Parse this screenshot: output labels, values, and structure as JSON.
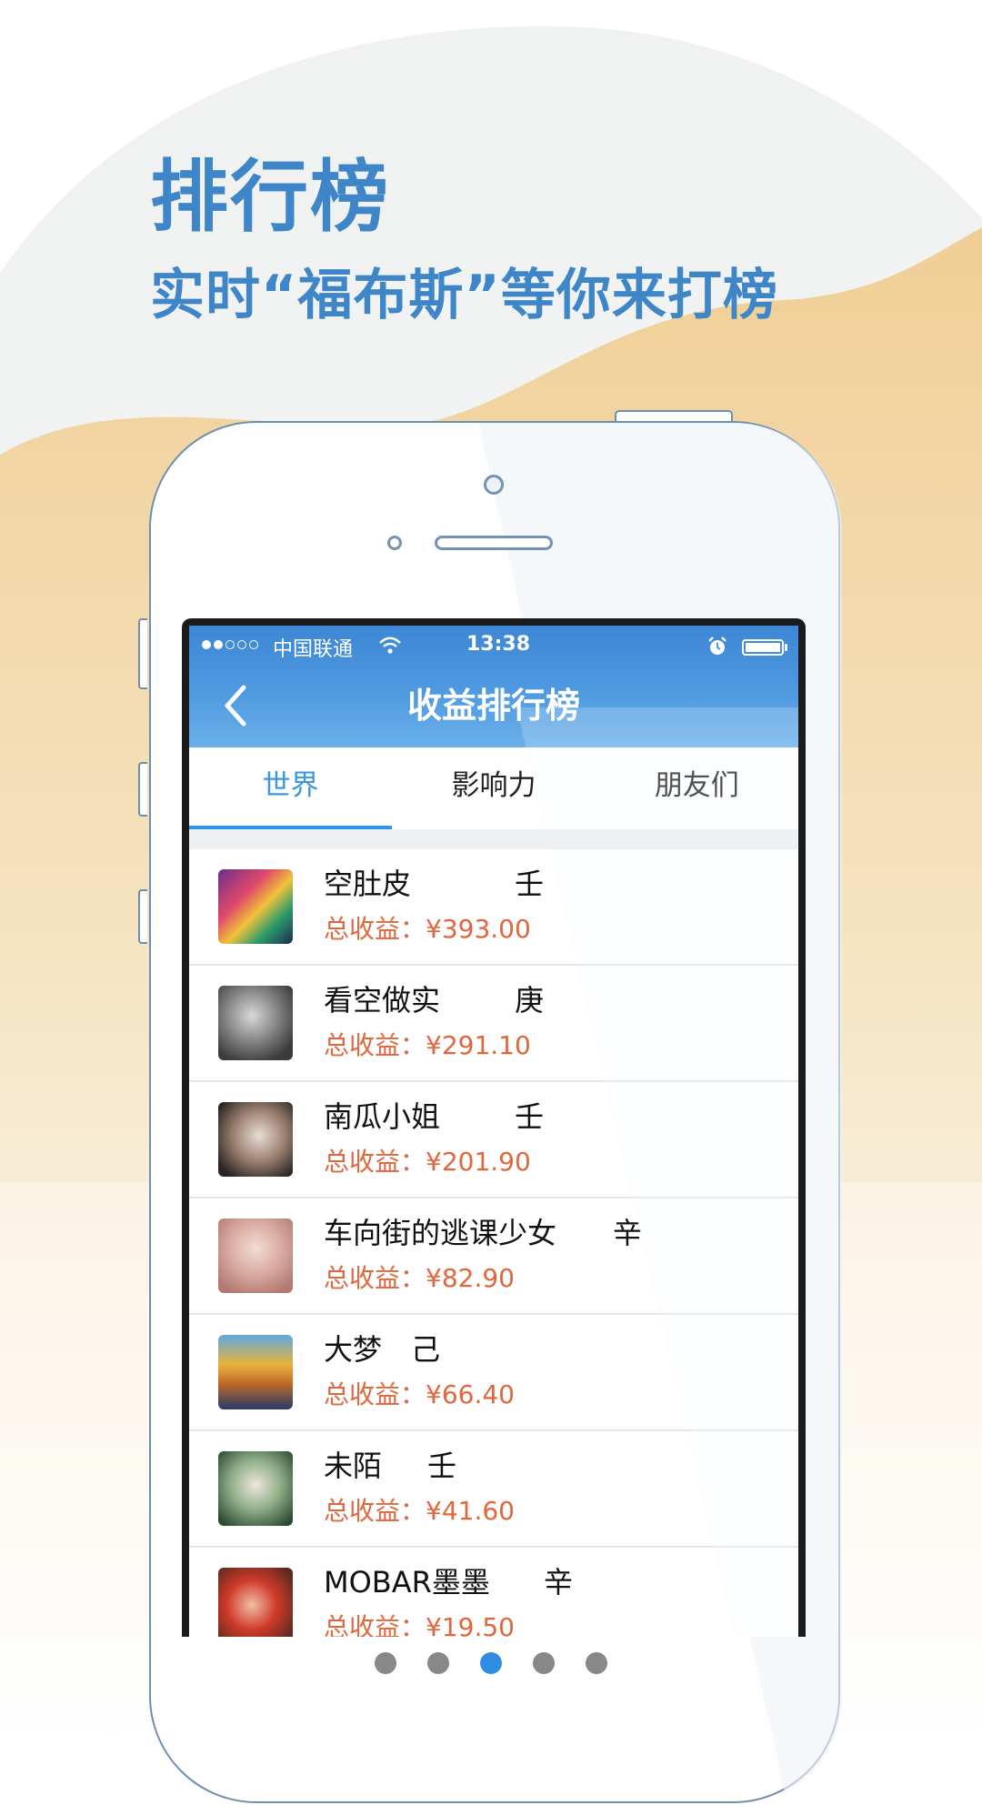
{
  "promo": {
    "title": "排行榜",
    "subtitle": "实时“福布斯”等你来打榜"
  },
  "status_bar": {
    "carrier": "中国联通",
    "time": "13:38",
    "signal_dots_filled": 2,
    "signal_dots_total": 5
  },
  "header": {
    "back_icon": "chevron-left-icon",
    "title": "收益排行榜"
  },
  "tabs": [
    {
      "label": "世界",
      "active": true
    },
    {
      "label": "影响力",
      "active": false
    },
    {
      "label": "朋友们",
      "active": false
    }
  ],
  "ranking": [
    {
      "name": "空肚皮",
      "tag": "壬",
      "earnings": "总收益：¥393.00"
    },
    {
      "name": "看空做实",
      "tag": "庚",
      "earnings": "总收益：¥291.10"
    },
    {
      "name": "南瓜小姐",
      "tag": "壬",
      "earnings": "总收益：¥201.90"
    },
    {
      "name": "车向街的逃课少女",
      "tag": "辛",
      "earnings": "总收益：¥82.90"
    },
    {
      "name": "大梦",
      "tag": "己",
      "earnings": "总收益：¥66.40"
    },
    {
      "name": "未陌",
      "tag": "壬",
      "earnings": "总收益：¥41.60"
    },
    {
      "name": "MOBAR墨墨",
      "tag": "辛",
      "earnings": "总收益：¥19.50"
    }
  ],
  "pager": {
    "total": 5,
    "active_index": 2
  },
  "colors": {
    "accent": "#3f86c9",
    "header_blue": "#4f9ae0",
    "earnings": "#e0663c",
    "tab_active": "#3a96e4",
    "pager_active": "#2f8ee0"
  }
}
